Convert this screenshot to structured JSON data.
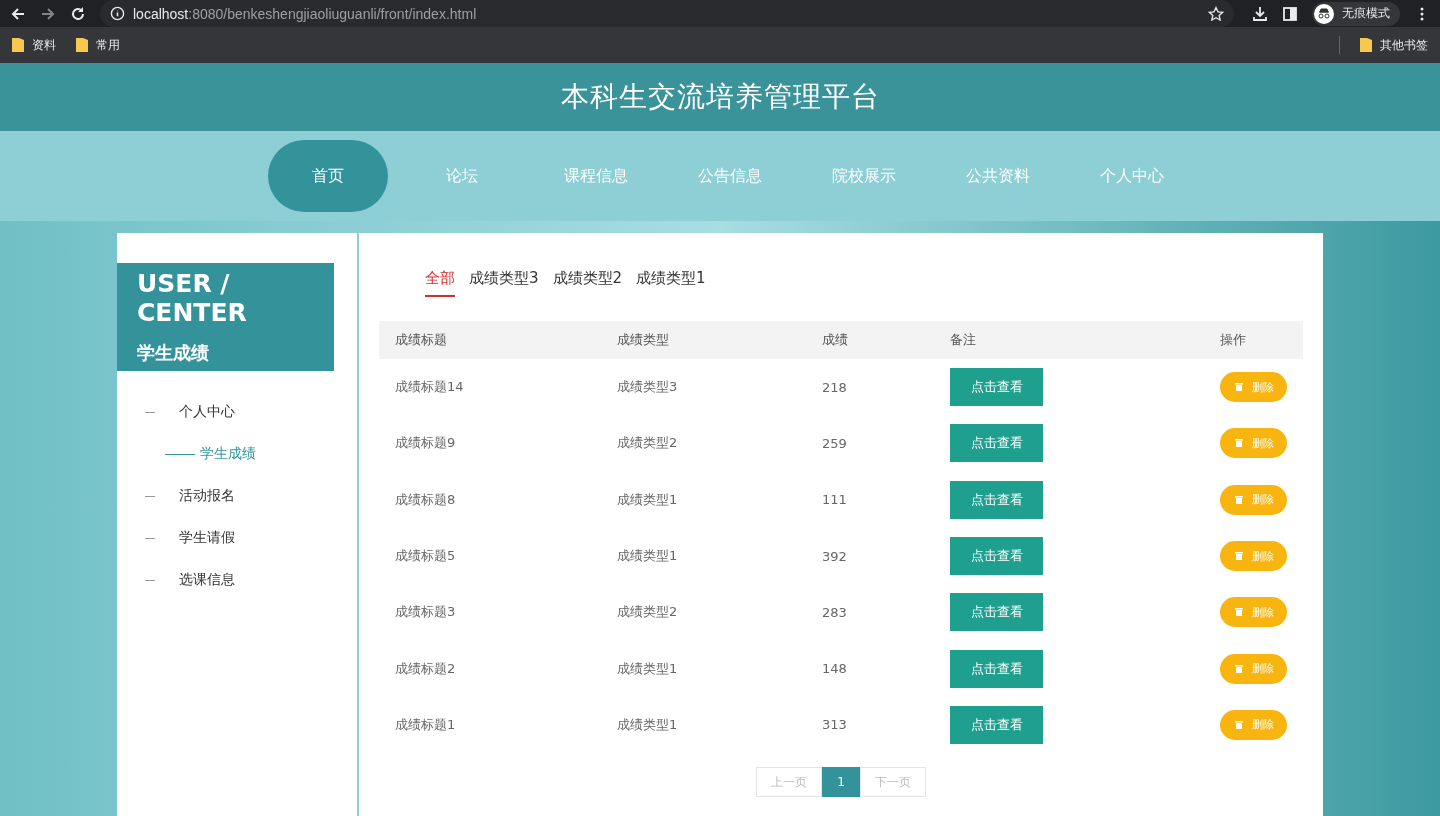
{
  "browser": {
    "url_host": "localhost",
    "url_rest": ":8080/benkeshengjiaoliuguanli/front/index.html",
    "bookmarks": [
      "资料",
      "常用"
    ],
    "other_bookmarks": "其他书签",
    "incognito": "无痕模式"
  },
  "site_title": "本科生交流培养管理平台",
  "nav": [
    {
      "label": "首页",
      "selected": true
    },
    {
      "label": "论坛",
      "selected": false
    },
    {
      "label": "课程信息",
      "selected": false
    },
    {
      "label": "公告信息",
      "selected": false
    },
    {
      "label": "院校展示",
      "selected": false
    },
    {
      "label": "公共资料",
      "selected": false
    },
    {
      "label": "个人中心",
      "selected": false
    }
  ],
  "sidebar": {
    "heading": "USER / CENTER",
    "subheading": "学生成绩",
    "items": [
      {
        "label": "个人中心",
        "selected": false,
        "children": [
          {
            "label": "学生成绩",
            "selected": true
          }
        ]
      },
      {
        "label": "活动报名",
        "selected": false
      },
      {
        "label": "学生请假",
        "selected": false
      },
      {
        "label": "选课信息",
        "selected": false
      }
    ]
  },
  "filters": [
    {
      "label": "全部",
      "selected": true
    },
    {
      "label": "成绩类型3",
      "selected": false
    },
    {
      "label": "成绩类型2",
      "selected": false
    },
    {
      "label": "成绩类型1",
      "selected": false
    }
  ],
  "table": {
    "columns": [
      "成绩标题",
      "成绩类型",
      "成绩",
      "备注",
      "操作"
    ],
    "rows": [
      {
        "title": "成绩标题14",
        "type": "成绩类型3",
        "score": "218",
        "view": "点击查看",
        "delete": "删除"
      },
      {
        "title": "成绩标题9",
        "type": "成绩类型2",
        "score": "259",
        "view": "点击查看",
        "delete": "删除"
      },
      {
        "title": "成绩标题8",
        "type": "成绩类型1",
        "score": "111",
        "view": "点击查看",
        "delete": "删除"
      },
      {
        "title": "成绩标题5",
        "type": "成绩类型1",
        "score": "392",
        "view": "点击查看",
        "delete": "删除"
      },
      {
        "title": "成绩标题3",
        "type": "成绩类型2",
        "score": "283",
        "view": "点击查看",
        "delete": "删除"
      },
      {
        "title": "成绩标题2",
        "type": "成绩类型1",
        "score": "148",
        "view": "点击查看",
        "delete": "删除"
      },
      {
        "title": "成绩标题1",
        "type": "成绩类型1",
        "score": "313",
        "view": "点击查看",
        "delete": "删除"
      }
    ]
  },
  "pagination": {
    "prev": "上一页",
    "pages": [
      {
        "label": "1",
        "selected": true
      }
    ],
    "next": "下一页"
  }
}
